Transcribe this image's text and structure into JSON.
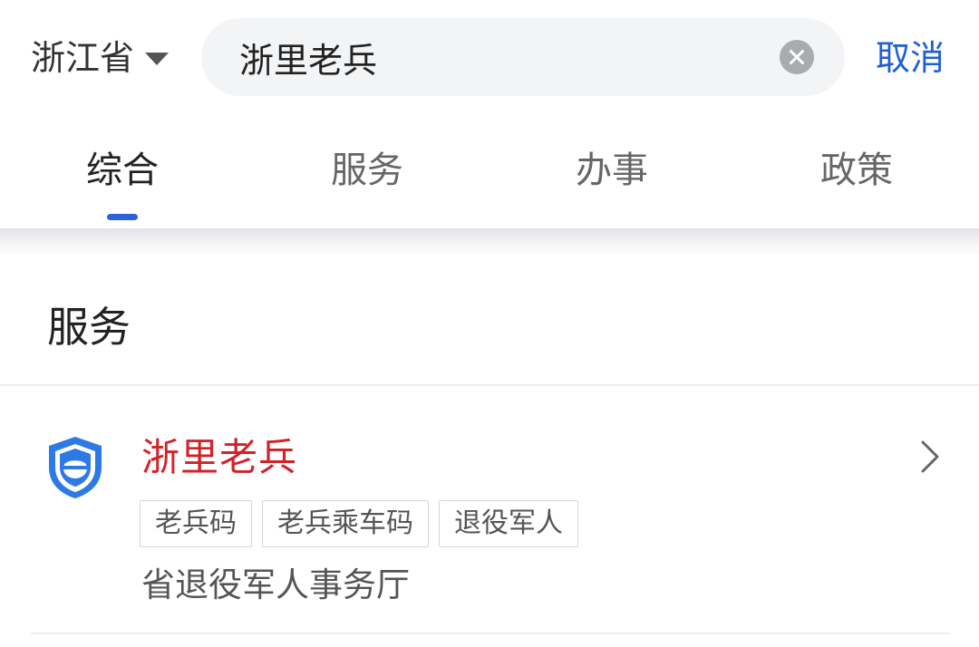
{
  "header": {
    "region_label": "浙江省",
    "search_value": "浙里老兵",
    "cancel_label": "取消"
  },
  "tabs": [
    {
      "label": "综合",
      "active": true
    },
    {
      "label": "服务",
      "active": false
    },
    {
      "label": "办事",
      "active": false
    },
    {
      "label": "政策",
      "active": false
    }
  ],
  "section": {
    "title": "服务"
  },
  "result": {
    "title": "浙里老兵",
    "icon": "veteran-shield-icon",
    "tags": [
      "老兵码",
      "老兵乘车码",
      "退役军人"
    ],
    "org": "省退役军人事务厅"
  },
  "colors": {
    "accent_blue": "#1f5fd6",
    "highlight_red": "#d0242a",
    "search_bg": "#f3f4f6"
  }
}
